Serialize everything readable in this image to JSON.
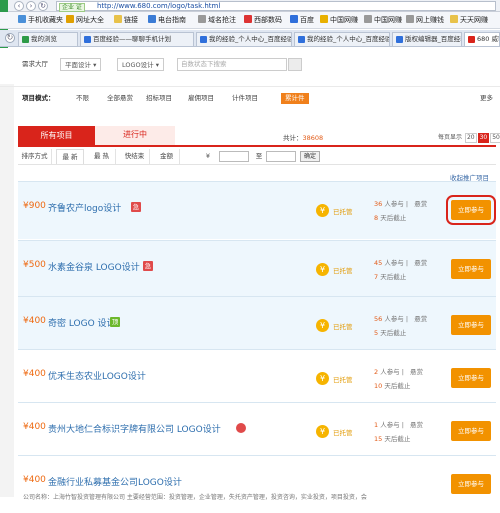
{
  "browser": {
    "url": "http://www.680.com/logo/task.html",
    "safe_label": "企业 证",
    "favorites": [
      {
        "label": "手机收藏夹",
        "icon": "phone-icon",
        "color": "#4a90d9"
      },
      {
        "label": "网址大全",
        "icon": "globe-icon",
        "color": "#e0a000"
      },
      {
        "label": "链接",
        "icon": "folder-icon",
        "color": "#e8c24a"
      },
      {
        "label": "电台指南",
        "icon": "radio-icon",
        "color": "#3a7bd5"
      },
      {
        "label": "域名抢注",
        "icon": "page-icon",
        "color": "#999999"
      },
      {
        "label": "西部数码",
        "icon": "cloud-icon",
        "color": "#d33"
      },
      {
        "label": "百度",
        "icon": "baidu-icon",
        "color": "#2f6fdb"
      },
      {
        "label": "中国网赚",
        "icon": "coin-icon",
        "color": "#e8b000"
      },
      {
        "label": "中国网赚",
        "icon": "page-icon",
        "color": "#999999"
      },
      {
        "label": "网上赚钱",
        "icon": "page-icon",
        "color": "#999999"
      },
      {
        "label": "天天网赚",
        "icon": "folder-icon",
        "color": "#e8c24a"
      }
    ],
    "tabs": [
      {
        "label": "我的浏览",
        "color": "#2e9b47",
        "active": false
      },
      {
        "label": "百度经验——聊聊手机计划",
        "color": "#2f6fdb",
        "active": false
      },
      {
        "label": "我的经验_个人中心_百度经验",
        "color": "#2f6fdb",
        "active": false
      },
      {
        "label": "我的经验_个人中心_百度经验",
        "color": "#2f6fdb",
        "active": false
      },
      {
        "label": "版权编辑器_百度经验",
        "color": "#2f6fdb",
        "active": false
      },
      {
        "label": "680 威客_时间财富网",
        "color": "#d9241b",
        "active": true
      }
    ]
  },
  "site": {
    "crumbs": [
      "需求大厅",
      "平面设计",
      "LOGO设计"
    ],
    "search_placeholder": "自数状态下搜索",
    "mode_title": "项目模式：",
    "modes": [
      "不限",
      "全部悬赏",
      "招标项目",
      "雇佣项目",
      "计件项目",
      "累计件"
    ],
    "more": "更多",
    "tab_all": "所有项目",
    "tab_ongoing": "进行中",
    "total_label": "共计：",
    "total_value": "38608",
    "perpage_label": "每页显示",
    "perpage_options": [
      "20",
      "30",
      "50"
    ],
    "sort": {
      "label": "排序方式",
      "options": [
        "最 新",
        "最 热",
        "快结束",
        "金额"
      ],
      "currency": "¥",
      "to": "至",
      "confirm": "确定"
    },
    "collapse_link": "收起推广项目",
    "tasks": [
      {
        "price": "¥900",
        "name": "齐鲁农产logo设计",
        "badge": "急",
        "badge_color": "#e04a4a",
        "hosted": "已托管",
        "participants": "36",
        "participants_label": "人参与",
        "reward": "悬赏",
        "deadline_num": "8",
        "deadline_label": "天后截止",
        "join": "立即参与",
        "company": ""
      },
      {
        "price": "¥500",
        "name": "水素金谷泉 LOGO设计",
        "badge": "急",
        "badge_color": "#e04a4a",
        "hosted": "已托管",
        "participants": "45",
        "participants_label": "人参与",
        "reward": "悬赏",
        "deadline_num": "7",
        "deadline_label": "天后截止",
        "join": "立即参与",
        "company": ""
      },
      {
        "price": "¥400",
        "name": "奇密 LOGO 设计",
        "badge": "顶",
        "badge_color": "#6cb82c",
        "hosted": "已托管",
        "participants": "56",
        "participants_label": "人参与",
        "reward": "悬赏",
        "deadline_num": "5",
        "deadline_label": "天后截止",
        "join": "立即参与",
        "company": ""
      },
      {
        "price": "¥400",
        "name": "优禾生态农业LOGO设计",
        "badge": "",
        "badge_color": "",
        "hosted": "已托管",
        "participants": "2",
        "participants_label": "人参与",
        "reward": "悬赏",
        "deadline_num": "10",
        "deadline_label": "天后截止",
        "join": "立即参与",
        "company": ""
      },
      {
        "price": "¥400",
        "name": "贵州大地仁合标识字牌有限公司 LOGO设计",
        "badge": "",
        "badge_color": "",
        "hosted": "已托管",
        "participants": "1",
        "participants_label": "人参与",
        "reward": "悬赏",
        "deadline_num": "15",
        "deadline_label": "天后截止",
        "join": "立即参与",
        "company": ""
      },
      {
        "price": "¥400",
        "name": "金融行业私募基金公司LOGO设计",
        "badge": "",
        "badge_color": "",
        "hosted": "",
        "participants": "",
        "participants_label": "",
        "reward": "",
        "deadline_num": "",
        "deadline_label": "",
        "join": "立即参与",
        "company": "公司名称：上海竹智投资管理有限公司  主要经营范围：投资管理，企业管理，失托资产管理，投资咨询，实业投资，项目投资，会"
      }
    ]
  }
}
